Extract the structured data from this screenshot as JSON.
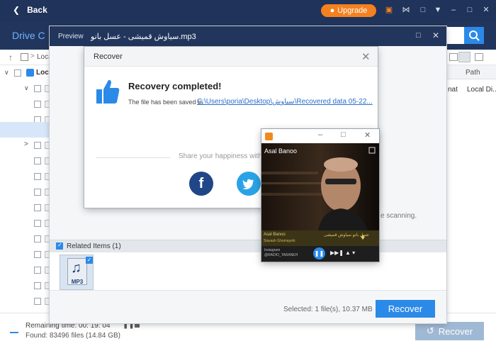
{
  "app": {
    "back_label": "Back",
    "upgrade_label": "Upgrade",
    "drive_title": "Drive C",
    "breadcrumb_partial": "Loca",
    "tree_root_label": "Loca",
    "column_path": "Path",
    "right_row_partial_1": "nat",
    "right_row_partial_2": "Local Di...",
    "scanning_partial": "e scanning.",
    "status_time": "Remaining time: 00: 19: 04",
    "status_found": "Found: 83496 files (14.84 GB)",
    "recover_label": "Recover",
    "accent_color": "#2b8ae8",
    "header_color": "#20335a",
    "upgrade_color": "#f4811f"
  },
  "preview": {
    "title_label": "Preview",
    "file_name": "سیاوش قمیشی - عسل بانو.mp3",
    "related_items_label": "Related Items (1)",
    "thumb_type": "MP3",
    "selected_text": "Selected: 1 file(s), 10.37 MB",
    "recover_label": "Recover"
  },
  "dialog": {
    "title": "Recover",
    "heading": "Recovery completed!",
    "saved_prefix": "The file has been saved in",
    "saved_path": "C:\\Users\\poria\\Desktop\\سیاوش\\Recovered data 05-22...",
    "share_text": "Share your happiness with",
    "facebook_glyph": "f",
    "twitter_glyph": "t"
  },
  "player": {
    "song_title": "Asal Banoo",
    "band_line_1": "Asal Banoo",
    "band_line_2": "Siavash Ghomayshi",
    "band_right": "عسل بانو  سیاوش قمیشی",
    "instagram_line_1": "Instagram",
    "instagram_line_2": "@RADIO_TARANEH"
  }
}
